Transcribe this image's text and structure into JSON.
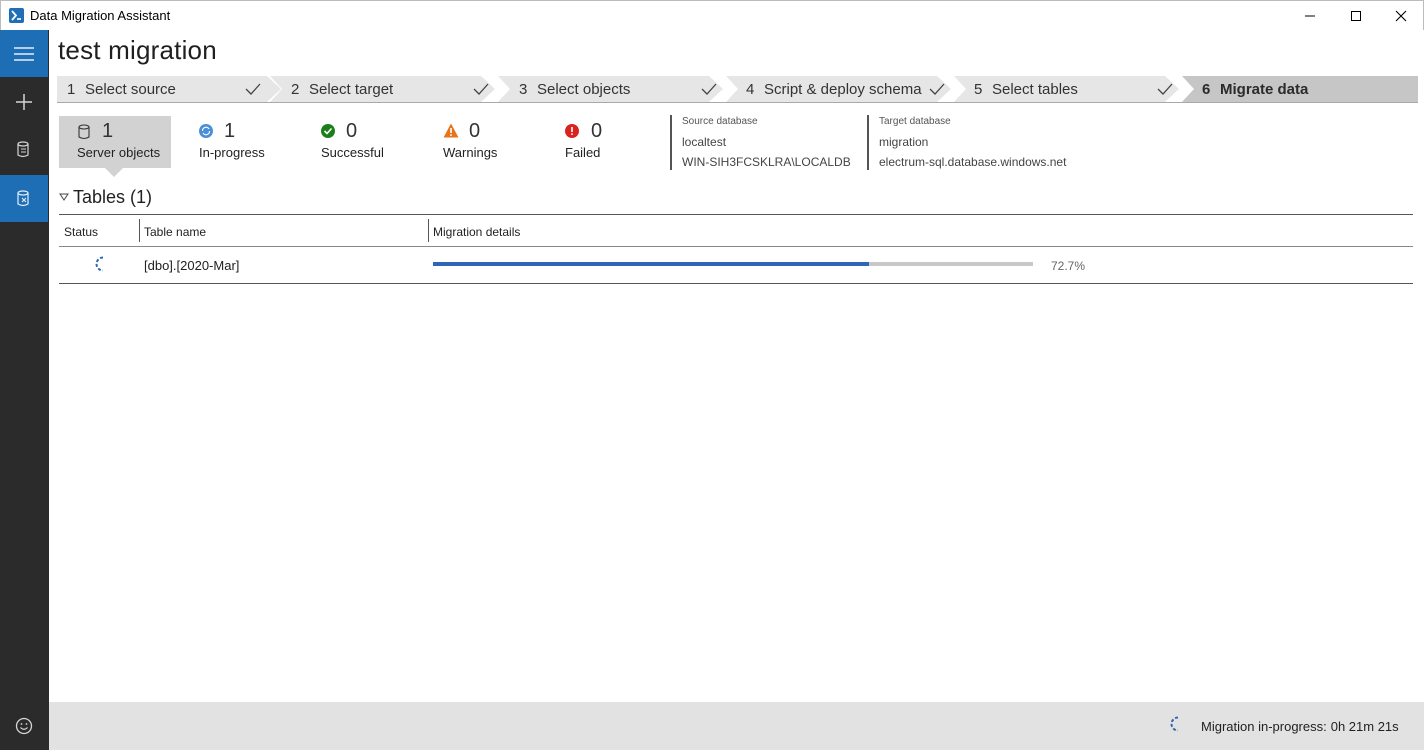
{
  "window": {
    "title": "Data Migration Assistant",
    "app_icon": "dma-logo-icon",
    "controls": [
      "minimize-icon",
      "maximize-icon",
      "close-icon"
    ]
  },
  "sidebar": {
    "items": [
      {
        "name": "menu",
        "icon": "hamburger-menu-icon"
      },
      {
        "name": "new-project",
        "icon": "plus-icon"
      },
      {
        "name": "assessments",
        "icon": "database-report-icon"
      },
      {
        "name": "migrations",
        "icon": "database-migrate-icon"
      },
      {
        "name": "feedback",
        "icon": "smiley-face-icon"
      }
    ]
  },
  "project": {
    "title": "test migration"
  },
  "steps": [
    {
      "num": "1",
      "label": "Select source",
      "done": true
    },
    {
      "num": "2",
      "label": "Select target",
      "done": true
    },
    {
      "num": "3",
      "label": "Select objects",
      "done": true
    },
    {
      "num": "4",
      "label": "Script & deploy schema",
      "done": true
    },
    {
      "num": "5",
      "label": "Select tables",
      "done": true
    },
    {
      "num": "6",
      "label": "Migrate data",
      "done": false
    }
  ],
  "stats": {
    "server_objects": {
      "value": "1",
      "label": "Server objects",
      "icon": "database-icon"
    },
    "in_progress": {
      "value": "1",
      "label": "In-progress",
      "icon": "sync-icon"
    },
    "successful": {
      "value": "0",
      "label": "Successful",
      "icon": "check-circle-icon"
    },
    "warnings": {
      "value": "0",
      "label": "Warnings",
      "icon": "warning-triangle-icon"
    },
    "failed": {
      "value": "0",
      "label": "Failed",
      "icon": "error-circle-icon"
    }
  },
  "source": {
    "caption": "Source database",
    "database": "localtest",
    "server": "WIN-SIH3FCSKLRA\\LOCALDB"
  },
  "target": {
    "caption": "Target database",
    "database": "migration",
    "server": "electrum-sql.database.windows.net"
  },
  "tables": {
    "header": "Tables (1)",
    "columns": {
      "status": "Status",
      "name": "Table name",
      "details": "Migration details"
    },
    "rows": [
      {
        "status_icon": "spinner-icon",
        "name": "[dbo].[2020-Mar]",
        "progress_percent": 72.7,
        "progress_text": "72.7%"
      }
    ]
  },
  "footer": {
    "status_label": "Migration in-progress:",
    "elapsed": "0h 21m 21s",
    "icon": "spinner-icon"
  },
  "colors": {
    "accent": "#1e6eb5",
    "progress": "#2f67b4",
    "success": "#1a7f1a",
    "warning": "#e8741a",
    "error": "#d9231f",
    "in_progress": "#4a8fd8"
  }
}
